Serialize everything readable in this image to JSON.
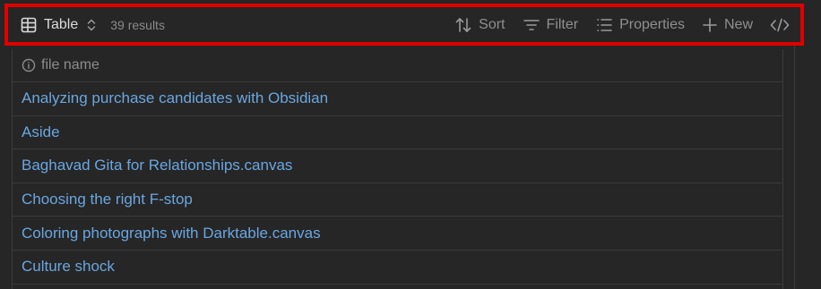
{
  "toolbar": {
    "view_label": "Table",
    "view_icon": "table-icon",
    "results": "39 results",
    "buttons": {
      "sort": "Sort",
      "filter": "Filter",
      "properties": "Properties",
      "new": "New"
    },
    "highlight_color": "#e00000"
  },
  "table": {
    "column_header": "file name",
    "column_icon": "info-icon",
    "rows": [
      "Analyzing purchase candidates with Obsidian",
      "Aside",
      "Baghavad Gita for Relationships.canvas",
      "Choosing the right F-stop",
      "Coloring photographs with Darktable.canvas",
      "Culture shock"
    ]
  },
  "colors": {
    "background": "#262626",
    "link": "#6aa6e0",
    "muted_text": "#8f8f8f",
    "border": "#3b3b3b"
  }
}
